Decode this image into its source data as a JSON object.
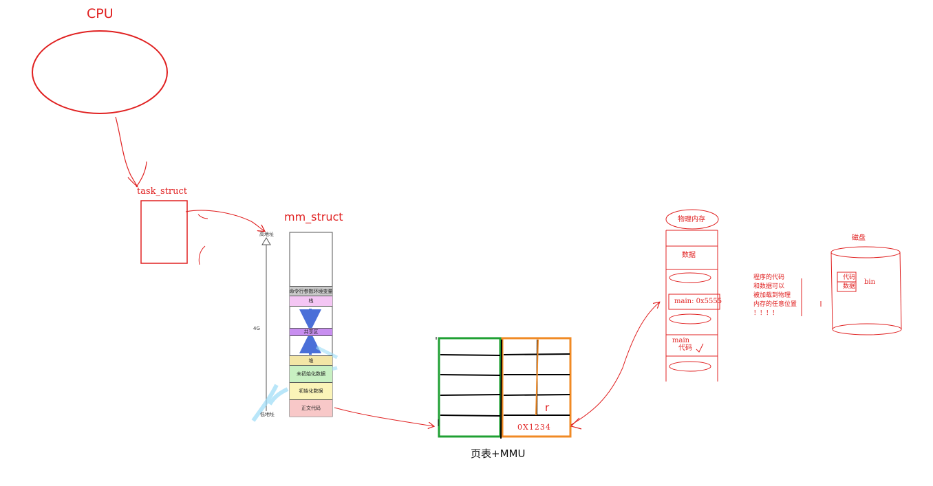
{
  "labels": {
    "cpu": "CPU",
    "task_struct": "task_struct",
    "mm_struct": "mm_struct",
    "high_addr": "高地址",
    "low_addr": "低地址",
    "size_4g": "4G",
    "page_table": "页表+MMU",
    "page_r": "r",
    "page_addr": "0X1234",
    "phys_mem": "物理内存",
    "phys_data": "数据",
    "phys_main_addr": "main: 0x5555",
    "phys_main": "main",
    "phys_code": "代码",
    "disk": "磁盘",
    "disk_code": "代码",
    "disk_data": "数据",
    "disk_bin": "bin",
    "note": [
      "程序的代码",
      "和数据可以",
      "被加载到物理",
      "内存的任意位置",
      "！！！！"
    ]
  },
  "mm_segments": [
    {
      "name": "env",
      "label": "命令行参数环境变量",
      "color": "#c9c9c9"
    },
    {
      "name": "stack",
      "label": "栈",
      "color": "#f4c6f4"
    },
    {
      "name": "shared",
      "label": "共享区",
      "color": "#c88ef0"
    },
    {
      "name": "heap",
      "label": "堆",
      "color": "#f3e6a6"
    },
    {
      "name": "bss",
      "label": "未初始化数据",
      "color": "#c8f0c2"
    },
    {
      "name": "data",
      "label": "初始化数据",
      "color": "#fbf4b8"
    },
    {
      "name": "text",
      "label": "正文代码",
      "color": "#f8c8c8"
    }
  ],
  "colors": {
    "annotation": "#e02020",
    "page_left_border": "#1fa033",
    "page_right_border": "#f08a24",
    "arrow_blue": "#4a6fd8"
  }
}
